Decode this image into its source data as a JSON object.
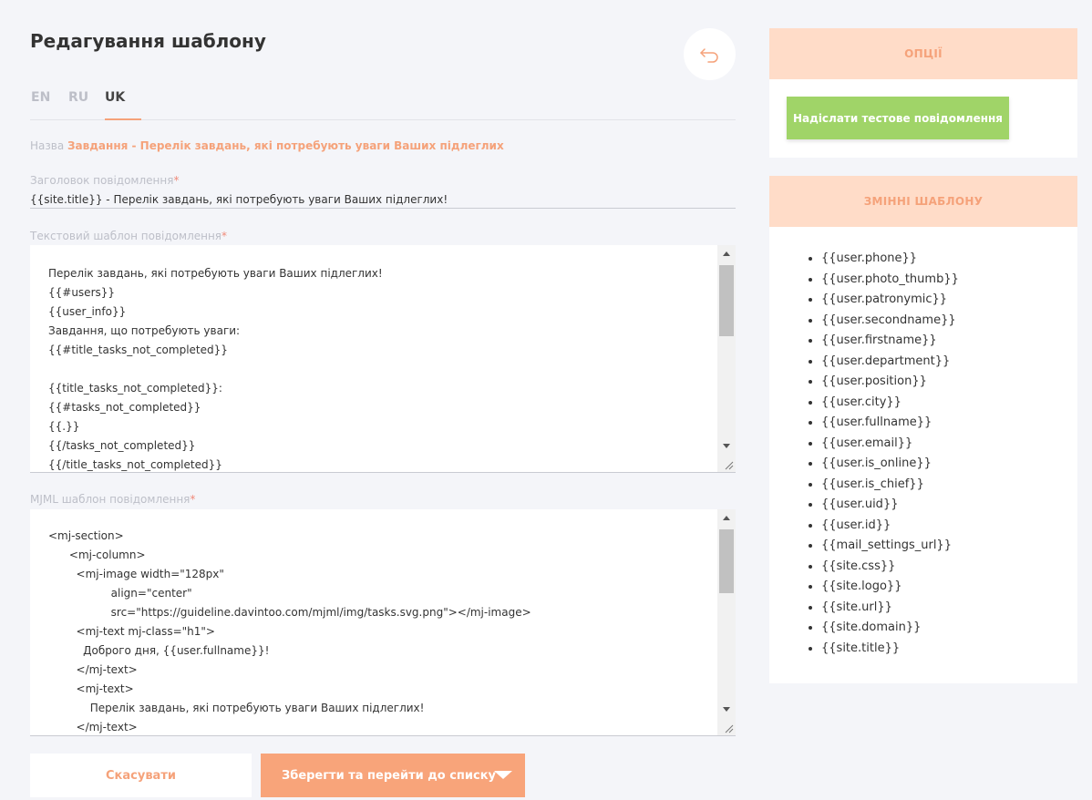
{
  "page": {
    "title": "Редагування шаблону"
  },
  "tabs": [
    {
      "label": "EN",
      "active": false
    },
    {
      "label": "RU",
      "active": false
    },
    {
      "label": "UK",
      "active": true
    }
  ],
  "name_row": {
    "label": "Назва",
    "value": "Завдання - Перелік завдань, які потребують уваги Ваших підлеглих"
  },
  "subject": {
    "label": "Заголовок повідомлення",
    "required_mark": "*",
    "value": "{{site.title}} - Перелік завдань, які потребують уваги Ваших підлеглих!"
  },
  "text_template": {
    "label": "Текстовий шаблон повідомлення",
    "required_mark": "*",
    "content": "Перелік завдань, які потребують уваги Ваших підлеглих!\n{{#users}}\n{{user_info}}\nЗавдання, що потребують уваги:\n{{#title_tasks_not_completed}}\n\n{{title_tasks_not_completed}}:\n{{#tasks_not_completed}}\n{{.}}\n{{/tasks_not_completed}}\n{{/title_tasks_not_completed}}"
  },
  "mjml_template": {
    "label": "MJML шаблон повідомлення",
    "required_mark": "*",
    "content": "<mj-section>\n      <mj-column>\n        <mj-image width=\"128px\"\n                  align=\"center\"\n                  src=\"https://guideline.davintoo.com/mjml/img/tasks.svg.png\"></mj-image>\n        <mj-text mj-class=\"h1\">\n          Доброго дня, {{user.fullname}}!\n        </mj-text>\n        <mj-text>\n            Перелік завдань, які потребують уваги Ваших підлеглих!\n        </mj-text>"
  },
  "actions": {
    "cancel_label": "Скасувати",
    "save_label": "Зберегти та перейти до списку"
  },
  "options_panel": {
    "title": "ОПЦІЇ",
    "test_button_label": "Надіслати тестове повідомлення"
  },
  "variables_panel": {
    "title": "ЗМІННІ ШАБЛОНУ",
    "items": [
      "{{user.phone}}",
      "{{user.photo_thumb}}",
      "{{user.patronymic}}",
      "{{user.secondname}}",
      "{{user.firstname}}",
      "{{user.department}}",
      "{{user.position}}",
      "{{user.city}}",
      "{{user.fullname}}",
      "{{user.email}}",
      "{{user.is_online}}",
      "{{user.is_chief}}",
      "{{user.uid}}",
      "{{user.id}}",
      "{{mail_settings_url}}",
      "{{site.css}}",
      "{{site.logo}}",
      "{{site.url}}",
      "{{site.domain}}",
      "{{site.title}}"
    ]
  },
  "colors": {
    "accent": "#f5a27a",
    "accent_button": "#f8a47a",
    "panel_header_bg": "#ffdcc8",
    "test_button": "#a0d468",
    "background": "#f4f5f9"
  },
  "icons": {
    "back": "undo-arrow-icon",
    "dropdown": "caret-down-icon"
  }
}
